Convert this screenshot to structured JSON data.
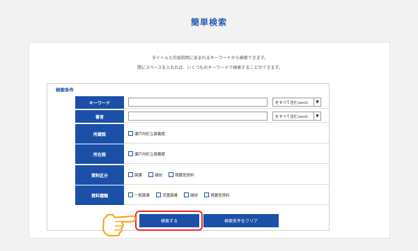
{
  "header": {
    "title": "簡単検索"
  },
  "description": {
    "line1": "タイトルと内容説明に含まれるキーワードから検索できます。",
    "line2": "間にスペースを入れれば、いくつものキーワードで検索することができます。"
  },
  "section_title": "検索条件",
  "fields": {
    "keyword": {
      "label": "キーワード",
      "value": "",
      "select": "をすべて含む(and)"
    },
    "author": {
      "label": "著者",
      "value": "",
      "select": "をすべて含む(and)"
    },
    "holding": {
      "label": "所蔵館",
      "options": [
        "瀬戸内町立図書館"
      ]
    },
    "location": {
      "label": "所在館",
      "options": [
        "瀬戸内町立図書館"
      ]
    },
    "material_type": {
      "label": "資料区分",
      "options": [
        "図書",
        "雑誌",
        "視聴覚資料"
      ]
    },
    "material_kind": {
      "label": "資料種類",
      "options": [
        "一般図書",
        "児童図書",
        "雑誌",
        "視聴覚資料"
      ]
    }
  },
  "buttons": {
    "search": "検索する",
    "clear": "検索条件をクリア"
  },
  "colors": {
    "primary": "#1b4fa8",
    "highlight": "#e8262d",
    "hand": "#f5a623"
  }
}
